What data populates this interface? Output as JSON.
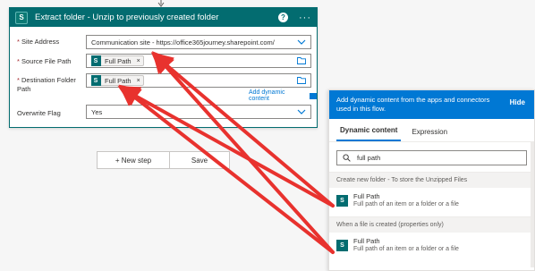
{
  "card": {
    "title": "Extract folder - Unzip to previously created folder",
    "logo_letter": "S",
    "help_glyph": "?",
    "more_glyph": "···"
  },
  "fields": {
    "site_address": {
      "label": "Site Address",
      "value": "Communication site - https://office365journey.sharepoint.com/"
    },
    "source_file_path": {
      "label": "Source File Path",
      "token": "Full Path"
    },
    "destination_folder_path": {
      "label": "Destination Folder Path",
      "token": "Full Path"
    },
    "overwrite_flag": {
      "label": "Overwrite Flag",
      "value": "Yes"
    },
    "required_mark": "*",
    "token_remove": "×"
  },
  "add_dynamic_label": "Add dynamic content",
  "buttons": {
    "new_step": "+ New step",
    "save": "Save"
  },
  "panel": {
    "header": "Add dynamic content from the apps and connectors used in this flow.",
    "hide": "Hide",
    "tabs": [
      "Dynamic content",
      "Expression"
    ],
    "search_value": "full path",
    "sections": [
      {
        "title": "Create new folder - To store the Unzipped Files",
        "items": [
          {
            "title": "Full Path",
            "desc": "Full path of an item or a folder or a file"
          }
        ]
      },
      {
        "title": "When a file is created (properties only)",
        "items": [
          {
            "title": "Full Path",
            "desc": "Full path of an item or a folder or a file"
          }
        ]
      }
    ]
  },
  "colors": {
    "accent": "#036c70",
    "panel_blue": "#0078d4",
    "arrow_red": "#e8322e"
  }
}
